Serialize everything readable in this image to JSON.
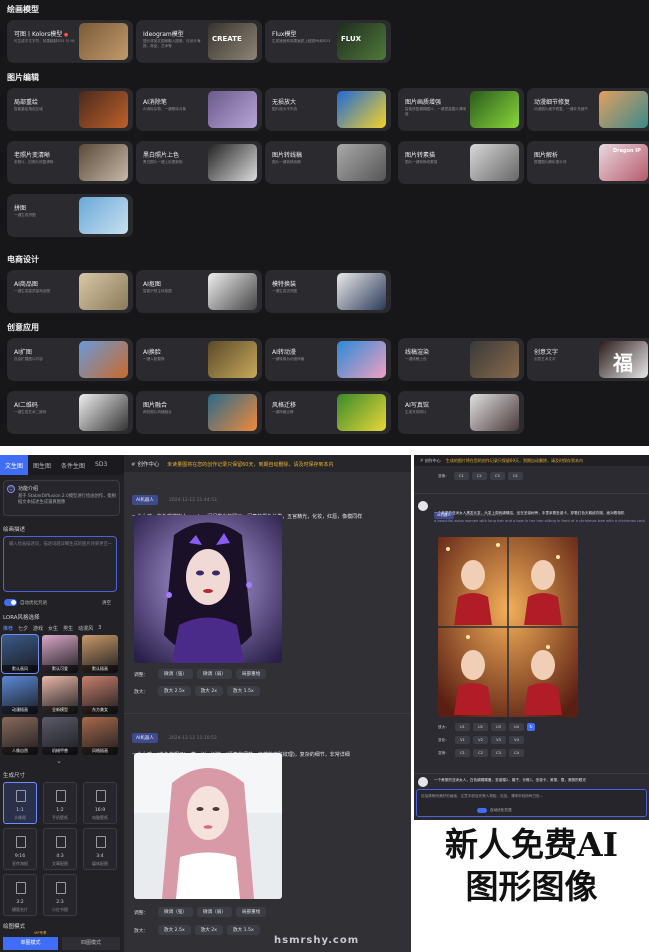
{
  "top": {
    "sections": [
      {
        "title": "绘画模型",
        "cards": [
          {
            "title": "可图丨Kolors模型",
            "hot": true,
            "desc": "可生成中文字符，效果超越SD3 与 MJ"
          },
          {
            "title": "Ideogram模型",
            "desc": "擅长将英文图案融入图像，可设计海报、商品、艺术等"
          },
          {
            "title": "Flux模型",
            "desc": "生成速度和效果画质上超越MJ和SD3"
          }
        ]
      },
      {
        "title": "图片编辑",
        "cards": [
          {
            "title": "局部重绘",
            "desc": "智能重绘指定区域"
          },
          {
            "title": "AI消除笔",
            "desc": "AI消除杂物，一键移除对象"
          },
          {
            "title": "无损放大",
            "desc": "图片放大不失真"
          },
          {
            "title": "图片画质增强",
            "desc": "智能修复模糊图片，一键提高图片清晰度"
          },
          {
            "title": "动漫细节修复",
            "desc": "动漫图片细节修复，一键补充细节"
          },
          {
            "title": "老照片变清晰",
            "desc": "老照片，旧照片修复清晰"
          },
          {
            "title": "黑白照片上色",
            "desc": "黑白图片一键上色更鲜艳"
          },
          {
            "title": "图片转线稿",
            "desc": "图片一键转换线稿"
          },
          {
            "title": "图片转素描",
            "desc": "图片一键转换成素描"
          },
          {
            "title": "图片解析",
            "desc": "根据图片解析提示词"
          },
          {
            "title": "拼图",
            "desc": "一键生成拼图"
          }
        ]
      },
      {
        "title": "电商设计",
        "cards": [
          {
            "title": "AI商品图",
            "desc": "一键生成高质量商品图"
          },
          {
            "title": "AI抠图",
            "desc": "智能识别主体抠图"
          },
          {
            "title": "模特换装",
            "desc": "一键生成试衣图"
          }
        ]
      },
      {
        "title": "创意应用",
        "cards": [
          {
            "title": "AI扩图",
            "desc": "自由扩展图片内容"
          },
          {
            "title": "AI换脸",
            "desc": "一键人脸替换"
          },
          {
            "title": "AI转动漫",
            "desc": "一键转换为动漫风格"
          },
          {
            "title": "线稿渲染",
            "desc": "一键线稿上色"
          },
          {
            "title": "创意文字",
            "desc": "创意艺术文字"
          },
          {
            "title": "AI二维码",
            "desc": "一键生成艺术二维码"
          },
          {
            "title": "图片融合",
            "desc": "两张图片风格融合"
          },
          {
            "title": "风格迁移",
            "desc": "一键风格迁移"
          },
          {
            "title": "AI写真馆",
            "desc": "生成写真照片"
          }
        ]
      }
    ],
    "thumb_texts": {
      "ideogram": "CREATE",
      "flux": "FLUX",
      "dragon": "Dragon IP",
      "creative": "福"
    }
  },
  "editor": {
    "tabs": [
      "文生图",
      "图生图",
      "条件生图",
      "SD3"
    ],
    "notice_title": "功能介绍",
    "notice_desc": "基于 StableDiffusion 2.0模型进行绘画创作，能根据文本描述生成逼真图像",
    "prompt_label": "绘画描述",
    "prompt_placeholder": "输入绘画描述词，描述词越详细生成的图片效果更佳~",
    "optimize_label": "自动优化咒语",
    "clear_label": "清空",
    "lora_label": "LORA风格选择",
    "lora_tabs": [
      "推荐",
      "七夕",
      "游戏",
      "女生",
      "男生",
      "动漫风",
      "3"
    ],
    "lora_items": [
      "默认画风",
      "默认可爱",
      "默认插画",
      "动漫插画",
      "全新模型",
      "东方美女",
      "人像自然",
      "机械甲兽",
      "风格插画"
    ],
    "size_label": "生成尺寸",
    "sizes": [
      {
        "ratio": "1:1",
        "name": "头像图"
      },
      {
        "ratio": "1:2",
        "name": "手机壁纸"
      },
      {
        "ratio": "16:9",
        "name": "电脑壁纸"
      },
      {
        "ratio": "9:16",
        "name": "宣传海报"
      },
      {
        "ratio": "4:3",
        "name": "文章配图"
      },
      {
        "ratio": "3:4",
        "name": "媒体配图"
      },
      {
        "ratio": "3:2",
        "name": "横版名片"
      },
      {
        "ratio": "2:3",
        "name": "小红书图"
      }
    ],
    "mode_label": "绘图模式",
    "vip": "VIP专享",
    "modes": [
      "单图模式",
      "四图模式"
    ]
  },
  "main": {
    "header": "创作中心",
    "warning": "未读量图将在您的创作记录只保留60天，到期自动删除，请及时保存到本内",
    "messages": [
      {
        "badge": "AI机器人",
        "time": "2024-12-12 11:44:53",
        "text": "一个女孩，紫色蝴蝶拟人，solo，闪闪发光的圆画，闪亮的黑色长发，五官精光，化妆，红唇，像模同样"
      },
      {
        "badge": "AI机器人",
        "time": "2024-12-12 11:10:53",
        "text": "一个女孩，(白色的帽子)，草，树，树枝，(逼真的细节，自然的皮肤纹理)，复杂的细节，非常详细"
      }
    ],
    "adjust_label": "调整：",
    "enlarge_label": "放大：",
    "adjust_buttons": [
      "微调（强）",
      "微调（弱）",
      "局部重绘"
    ],
    "enlarge_buttons": [
      "放大 2.5x",
      "放大 2x",
      "放大 1.5x"
    ]
  },
  "right": {
    "header": "创作中心",
    "warning": "生成的图片将在您的创作记录只保留60天，到期自动删除，请及时保存到本内",
    "badge": "AI机器人",
    "time": "2024-12-12 11:44:53",
    "prompt": "一个美丽的亚洲女人黑发长发，头发上带有蝴蝶结，坐在圣诞树旁，手里拿着圣诞卡，穿着红色天鹅绒衣服，面对着相机",
    "prompt_en": "a beautiful asian women with long hair and a bow in her hair sitting in front of a christmas tree with a christmas card",
    "rows": [
      {
        "label": "放大：",
        "buttons": [
          "U1",
          "U2",
          "U3",
          "U4"
        ]
      },
      {
        "label": "变化：",
        "buttons": [
          "V1",
          "V2",
          "V3",
          "V4"
        ]
      },
      {
        "label": "变换：",
        "buttons": [
          "C1",
          "C2",
          "C3",
          "C4"
        ]
      }
    ],
    "top_row": [
      "C1",
      "C2",
      "C3",
      "C4"
    ],
    "msg2": "一个美丽的亚洲女人，白色蝴蝶嘴唇，圣诞帽2，帽子，长靴1，圣诞卡，美丽，雪，美丽的眼光",
    "input_text": "包括清晰而美好的画面，注意手部及完美人物脸，包括，清晰年轻而有白色...",
    "optimize_label": "自动优化咒语"
  },
  "caption": {
    "line1": "新人免费AI",
    "line2": "图形图像"
  },
  "watermark": "hsmrshy.com"
}
